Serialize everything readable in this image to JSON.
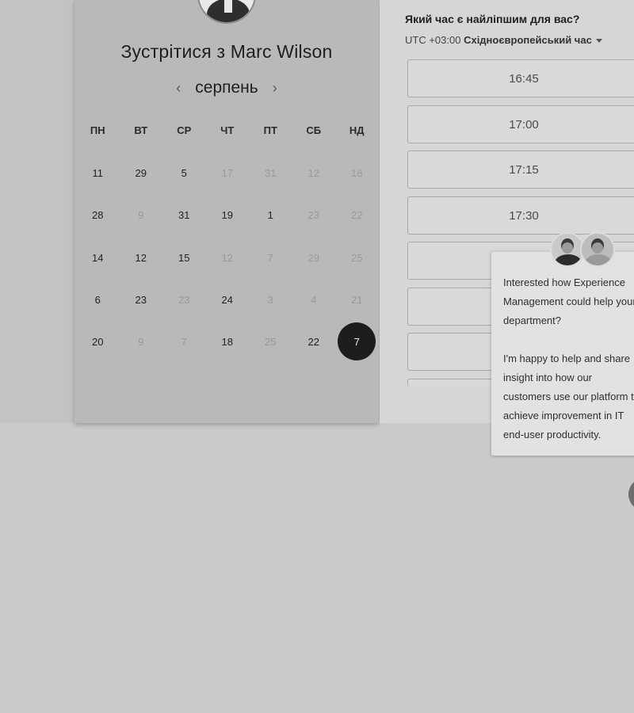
{
  "calendar": {
    "title": "Зустрітися з Marc Wilson",
    "month": "серпень",
    "prev_arrow": "‹",
    "next_arrow": "›",
    "weekdays": [
      "ПН",
      "ВТ",
      "СР",
      "ЧТ",
      "ПТ",
      "СБ",
      "НД"
    ],
    "weeks": [
      [
        {
          "d": "11",
          "s": "active"
        },
        {
          "d": "29",
          "s": "active"
        },
        {
          "d": "5",
          "s": "active"
        },
        {
          "d": "17",
          "s": "muted"
        },
        {
          "d": "31",
          "s": "muted"
        },
        {
          "d": "12",
          "s": "muted"
        },
        {
          "d": "18",
          "s": "muted"
        }
      ],
      [
        {
          "d": "28",
          "s": "active"
        },
        {
          "d": "9",
          "s": "muted"
        },
        {
          "d": "31",
          "s": "active"
        },
        {
          "d": "19",
          "s": "active"
        },
        {
          "d": "1",
          "s": "active"
        },
        {
          "d": "23",
          "s": "muted"
        },
        {
          "d": "22",
          "s": "muted"
        }
      ],
      [
        {
          "d": "14",
          "s": "active"
        },
        {
          "d": "12",
          "s": "active"
        },
        {
          "d": "15",
          "s": "active"
        },
        {
          "d": "12",
          "s": "muted"
        },
        {
          "d": "7",
          "s": "muted"
        },
        {
          "d": "29",
          "s": "muted"
        },
        {
          "d": "25",
          "s": "muted"
        }
      ],
      [
        {
          "d": "6",
          "s": "active"
        },
        {
          "d": "23",
          "s": "active"
        },
        {
          "d": "23",
          "s": "muted"
        },
        {
          "d": "24",
          "s": "active"
        },
        {
          "d": "3",
          "s": "muted"
        },
        {
          "d": "4",
          "s": "muted"
        },
        {
          "d": "21",
          "s": "muted"
        }
      ],
      [
        {
          "d": "20",
          "s": "active"
        },
        {
          "d": "9",
          "s": "muted"
        },
        {
          "d": "7",
          "s": "muted"
        },
        {
          "d": "18",
          "s": "active"
        },
        {
          "d": "25",
          "s": "muted"
        },
        {
          "d": "22",
          "s": "active"
        },
        {
          "d": "7",
          "s": "selected"
        }
      ]
    ]
  },
  "times": {
    "question": "Який час є найліпшим для вас?",
    "tz_offset": "UTC +03:00",
    "tz_name": "Східноєвропейський час",
    "slots": [
      "16:45",
      "17:00",
      "17:15",
      "17:30",
      "",
      "",
      "",
      ""
    ]
  },
  "chat": {
    "message": "Interested how Experience Management could help your department?\n\nI'm happy to help and share insight into how our customers use our platform to achieve improvement in IT end-user productivity."
  },
  "colors": {
    "selected_day": "#1d1d1d",
    "panel_bg": "#d6d6d6"
  }
}
